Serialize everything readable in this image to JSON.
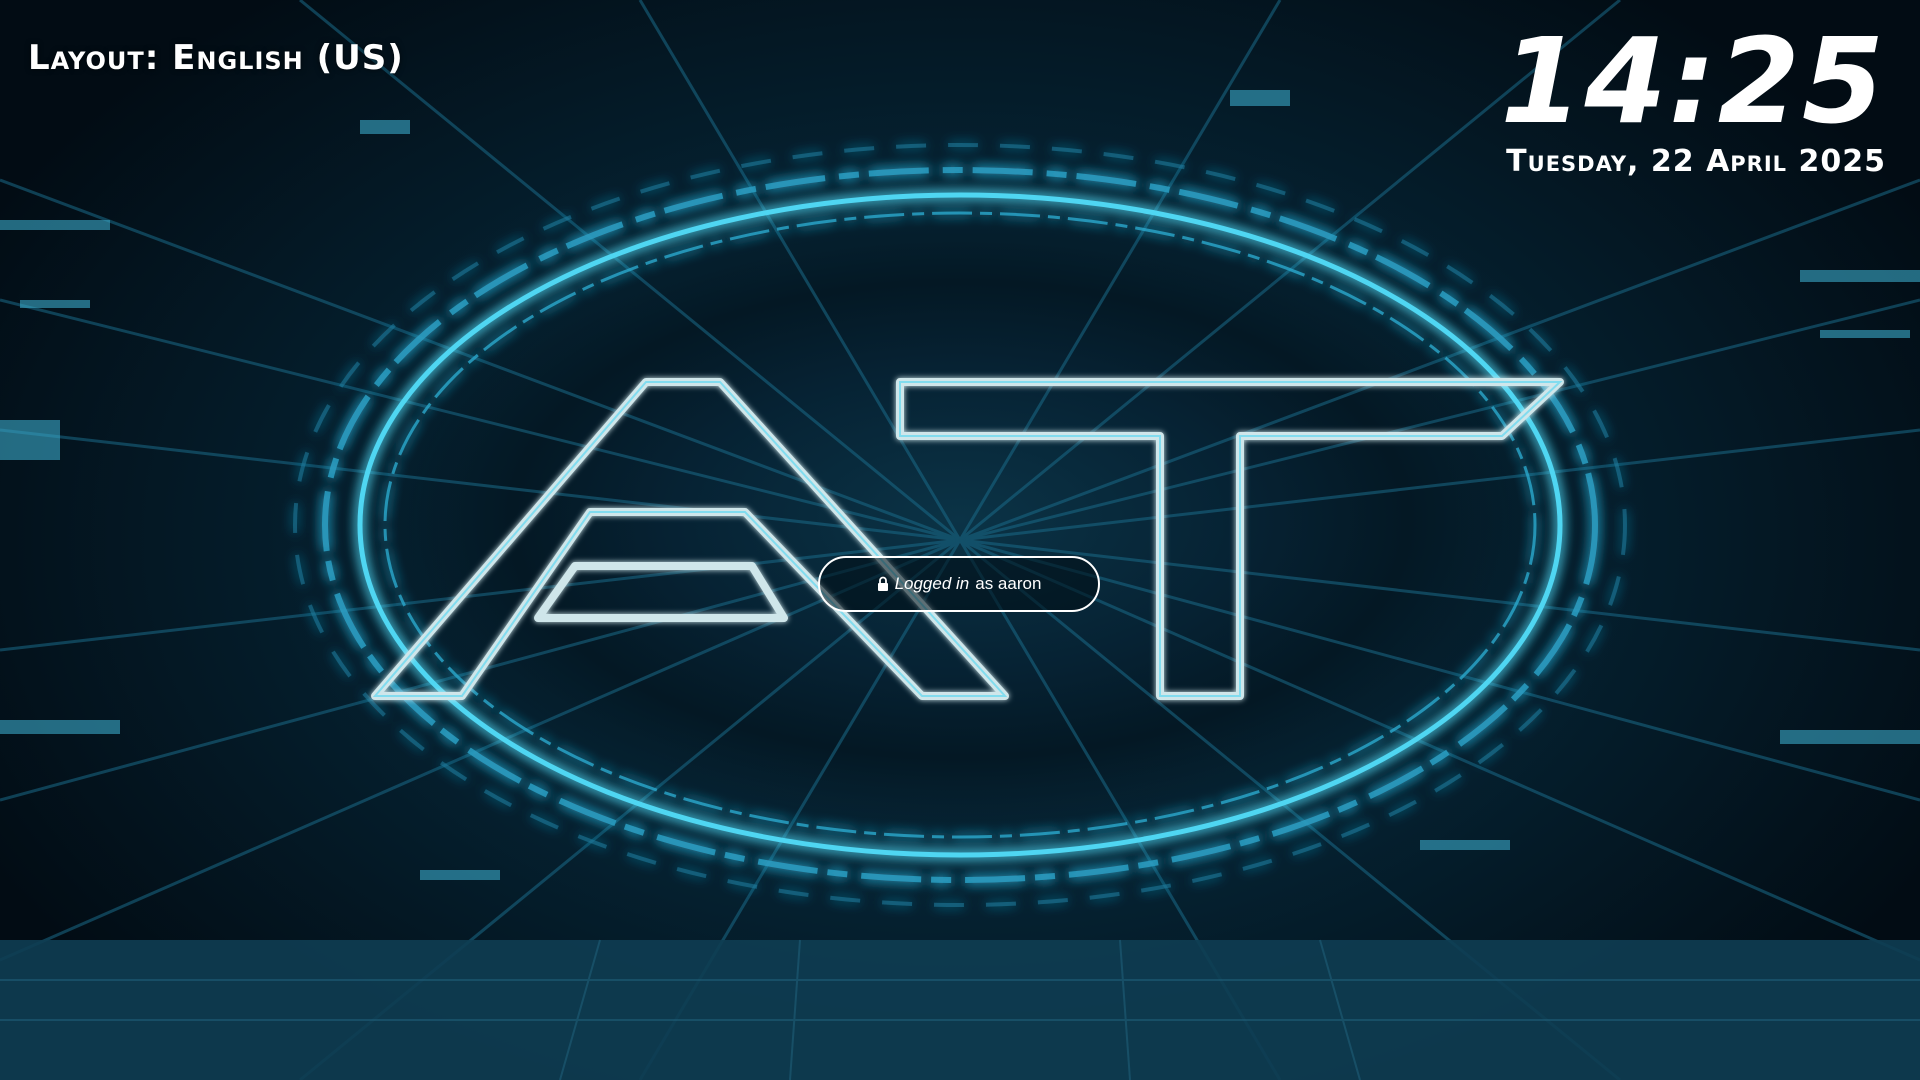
{
  "lockscreen": {
    "keyboard_layout_label": "Layout: English (US)",
    "clock_time": "14:25",
    "clock_date": "Tuesday, 22 April 2025",
    "logo_text": "AT",
    "login_prefix": "Logged in",
    "login_suffix": "as aaron",
    "lock_icon": "lock-icon"
  },
  "colors": {
    "accent_neon": "#4fd6f2",
    "text": "#ffffff",
    "background": "#041824"
  }
}
